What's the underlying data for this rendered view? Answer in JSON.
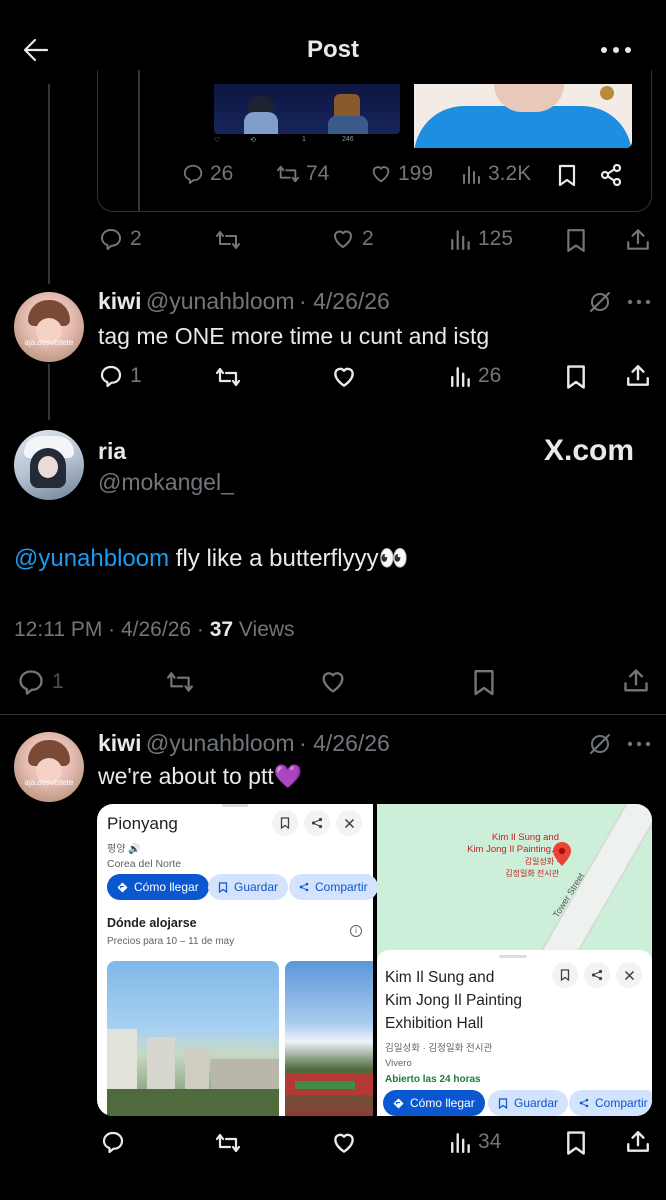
{
  "header": {
    "title": "Post",
    "back_icon": "arrow-left-icon",
    "more_icon": "more-horizontal-icon"
  },
  "quoted_media": {
    "mini_bar": [
      "1",
      "246"
    ],
    "actions": {
      "replies": "26",
      "reposts": "74",
      "likes": "199",
      "views": "3.2K"
    }
  },
  "prev_tweet_actions": {
    "replies": "2",
    "likes": "2",
    "views": "125"
  },
  "tweet1": {
    "name": "kiwi",
    "handle": "@yunahbloom",
    "date": "· 4/26/26",
    "avatar_watermark": "aja.desvistete",
    "text": "tag me ONE more time u cunt and istg",
    "actions": {
      "replies": "1",
      "views": "26"
    }
  },
  "embedded": {
    "name": "ria",
    "handle": "@mokangel_",
    "brand": "X.com",
    "mention": "@yunahbloom",
    "text": " fly like a butterflyyy👀",
    "timestamp": "12:11 PM · 4/26/26 · ",
    "views_count": "37",
    "views_label": " Views",
    "replies": "1"
  },
  "tweet2": {
    "name": "kiwi",
    "handle": "@yunahbloom",
    "date": "· 4/26/26",
    "avatar_watermark": "aja.desvistete",
    "text": "we're about to ptt💜",
    "views": "34"
  },
  "map_left": {
    "title": "Pionyang",
    "korean": "평양",
    "subtitle": "Corea del Norte",
    "btn_directions": "Cómo llegar",
    "btn_save": "Guardar",
    "btn_share": "Compartir",
    "section": "Dónde alojarse",
    "section_sub": "Precios para 10 – 11 de may"
  },
  "map_right": {
    "pin_label_1": "Kim Il Sung and",
    "pin_label_2": "Kim Jong Il Painting...",
    "pin_label_3": "김일성화 ·",
    "pin_label_4": "김정일화 전시관",
    "street": "Tower Street",
    "title_1": "Kim Il Sung and",
    "title_2": "Kim Jong Il Painting",
    "title_3": "Exhibition Hall",
    "korean": "김일성화 · 김정일화 전시관",
    "category": "Vivero",
    "hours": "Abierto las 24 horas",
    "btn_directions": "Cómo llegar",
    "btn_save": "Guardar",
    "btn_share": "Compartir"
  },
  "colors": {
    "accent": "#1d9bf0",
    "muted": "#71767b",
    "maps_blue": "#0b57d0",
    "open_green": "#188038"
  }
}
